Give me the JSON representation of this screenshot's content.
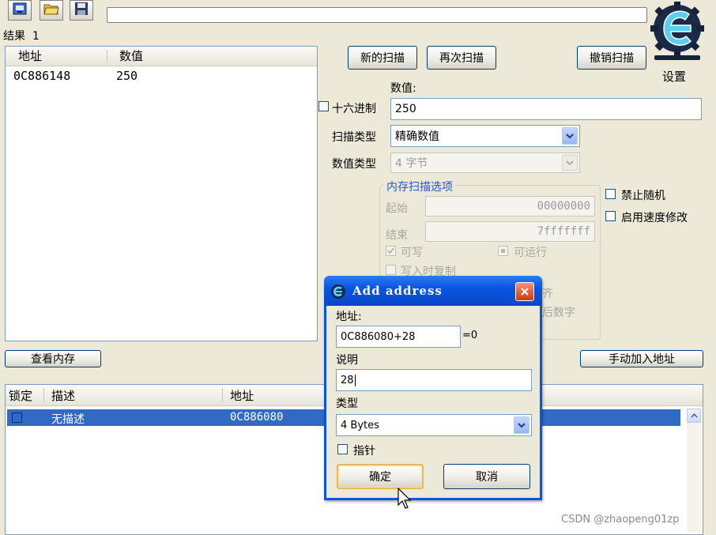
{
  "toolbar": {
    "icons": [
      "process-icon",
      "open-folder-icon",
      "save-disk-icon"
    ],
    "window_title": ""
  },
  "results": {
    "label": "结果",
    "count": "1",
    "columns": [
      "地址",
      "数值"
    ],
    "rows": [
      {
        "address": "0C886148",
        "value": "250"
      }
    ]
  },
  "scan": {
    "new_scan": "新的扫描",
    "next_scan": "再次扫描",
    "undo_scan": "撤销扫描",
    "settings": "设置",
    "value_label": "数值:",
    "hex_label": "十六进制",
    "value": "250",
    "scan_type_label": "扫描类型",
    "scan_type": "精确数值",
    "value_type_label": "数值类型",
    "value_type": "4 字节",
    "mem_options_title": "内存扫描选项",
    "start_label": "起始",
    "start": "00000000",
    "end_label": "结束",
    "end": "7fffffff",
    "writable": "可写",
    "executable": "可运行",
    "copy_on_write": "写入时复制",
    "hidden_text_1": "齐",
    "hidden_text_2": "后数字",
    "no_random": "禁止随机",
    "speedhack": "启用速度修改"
  },
  "buttons": {
    "view_memory": "查看内存",
    "add_manually": "手动加入地址"
  },
  "address_list": {
    "columns": [
      "锁定",
      "描述",
      "地址"
    ],
    "rows": [
      {
        "description": "无描述",
        "address": "0C886080"
      }
    ]
  },
  "dialog": {
    "title": "Add address",
    "address_label": "地址:",
    "address": "0C886080+28",
    "eval": "=0",
    "desc_label": "说明",
    "description": "28",
    "type_label": "类型",
    "type": "4 Bytes",
    "pointer": "指针",
    "ok": "确定",
    "cancel": "取消"
  },
  "watermark": "CSDN @zhaopeng01zp",
  "colors": {
    "window_bg": "#ece9d8",
    "xp_blue": "#0a55e0",
    "selection": "#316ac5",
    "close_red": "#e2592c",
    "group_title": "#2254d6"
  }
}
